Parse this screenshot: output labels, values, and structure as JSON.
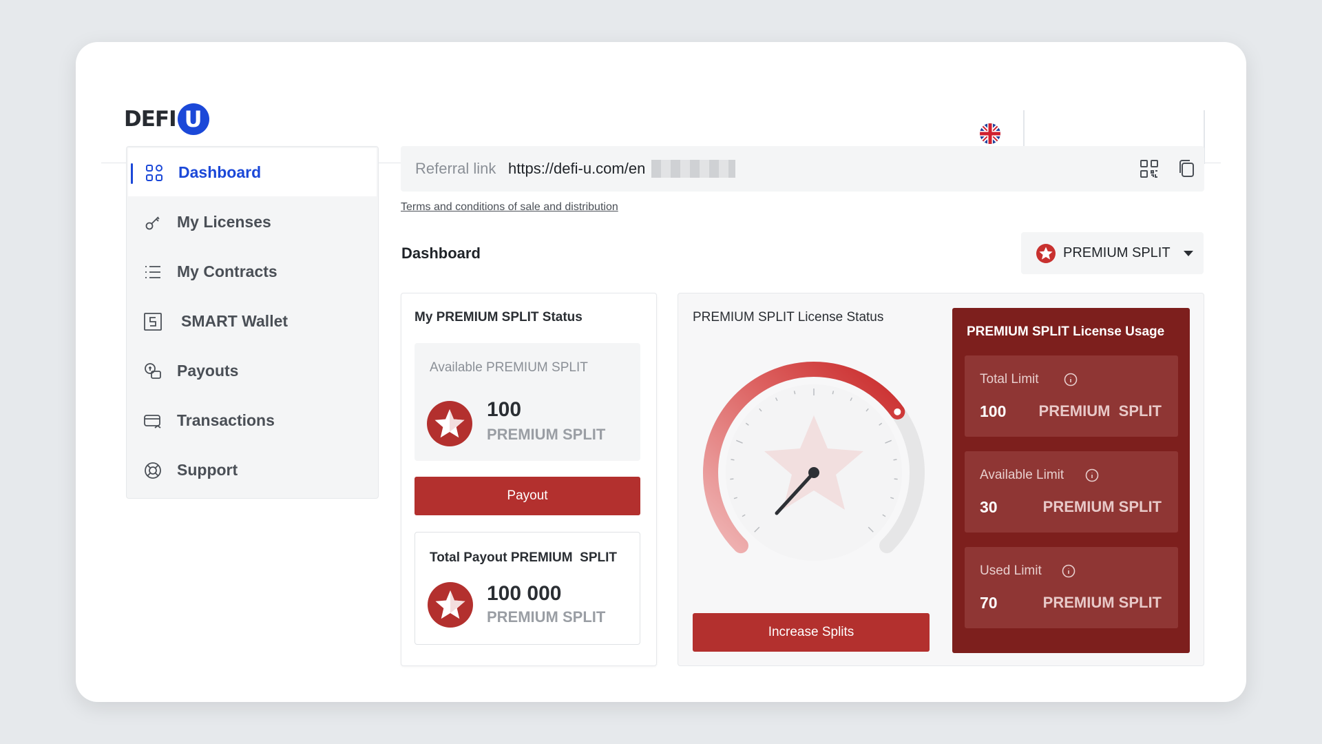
{
  "header": {
    "logo_text": "DEFI",
    "logo_badge": "U",
    "language_icon": "uk-flag-icon"
  },
  "sidebar": {
    "items": [
      {
        "label": "Dashboard",
        "icon": "grid-icon",
        "active": true
      },
      {
        "label": "My Licenses",
        "icon": "key-icon"
      },
      {
        "label": "My Contracts",
        "icon": "list-icon"
      },
      {
        "label": "SMART Wallet",
        "icon": "wallet-icon"
      },
      {
        "label": "Payouts",
        "icon": "coins-icon"
      },
      {
        "label": "Transactions",
        "icon": "card-icon"
      },
      {
        "label": "Support",
        "icon": "lifebuoy-icon"
      }
    ]
  },
  "referral": {
    "label": "Referral link",
    "value": "https://defi-u.com/en"
  },
  "terms_link": "Terms and conditions of sale and distribution",
  "dashboard": {
    "title": "Dashboard",
    "selector_value": "PREMIUM SPLIT"
  },
  "status": {
    "title": "My PREMIUM SPLIT Status",
    "available_label": "Available PREMIUM SPLIT",
    "available_value": "100",
    "available_unit": "PREMIUM SPLIT",
    "payout_button": "Payout",
    "total_label": "Total Payout PREMIUM  SPLIT",
    "total_value": "100 000",
    "total_unit": "PREMIUM SPLIT"
  },
  "license": {
    "title": "PREMIUM SPLIT License Status",
    "gauge_fraction": 0.7,
    "increase_button": "Increase Splits"
  },
  "usage": {
    "title": "PREMIUM SPLIT License Usage",
    "boxes": [
      {
        "label": "Total Limit",
        "value": "100",
        "unit": "PREMIUM  SPLIT"
      },
      {
        "label": "Available Limit",
        "value": "30",
        "unit": "PREMIUM SPLIT"
      },
      {
        "label": "Used Limit",
        "value": "70",
        "unit": "PREMIUM SPLIT"
      }
    ]
  },
  "colors": {
    "brand_blue": "#1b48d8",
    "accent_red": "#b3302e",
    "usage_panel": "#7d1f1d"
  }
}
